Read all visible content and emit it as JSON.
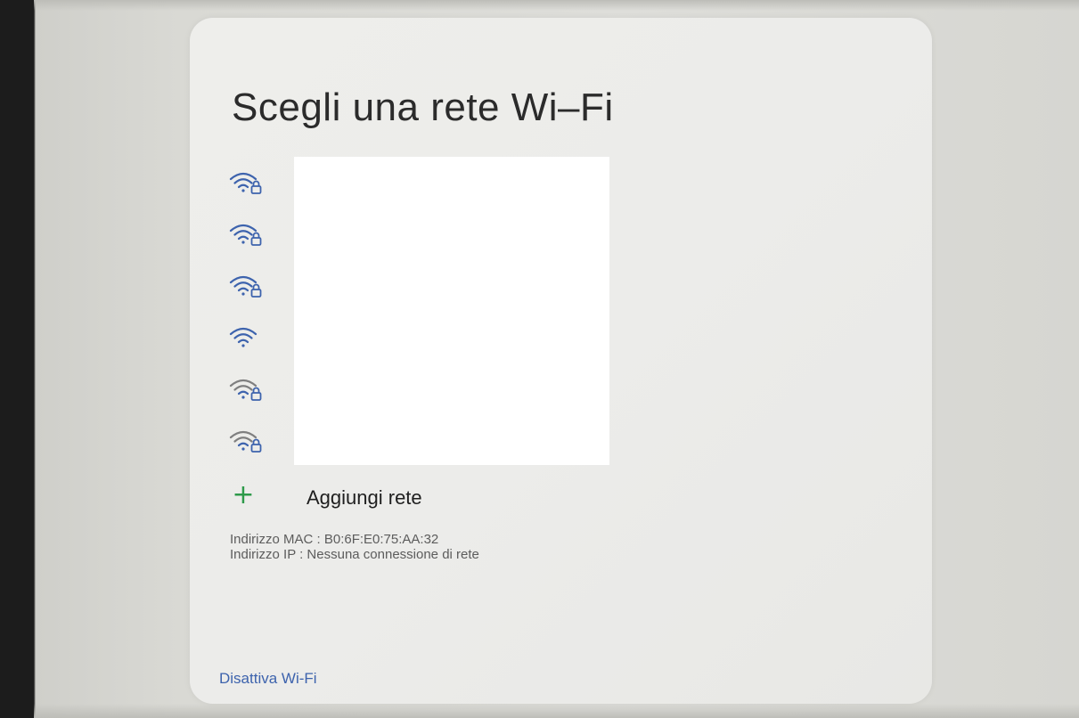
{
  "dialog": {
    "title": "Scegli una rete Wi–Fi"
  },
  "networks": [
    {
      "icon": "wifi-locked-icon",
      "color": "#3d63ad"
    },
    {
      "icon": "wifi-locked-icon",
      "color": "#3d63ad"
    },
    {
      "icon": "wifi-locked-icon",
      "color": "#3d63ad"
    },
    {
      "icon": "wifi-open-icon",
      "color": "#3d63ad"
    },
    {
      "icon": "wifi-locked-icon",
      "color": "#7f7f7f"
    },
    {
      "icon": "wifi-locked-icon",
      "color": "#7f7f7f"
    }
  ],
  "add_network": {
    "icon": "plus-icon",
    "icon_glyph": "+",
    "label": "Aggiungi rete",
    "icon_color": "#2e9a4a"
  },
  "info": {
    "mac": "Indirizzo MAC : B0:6F:E0:75:AA:32",
    "ip": "Indirizzo IP : Nessuna connessione di rete"
  },
  "footer": {
    "disable_wifi_label": "Disattiva Wi-Fi",
    "accent_color": "#3d63ad"
  }
}
